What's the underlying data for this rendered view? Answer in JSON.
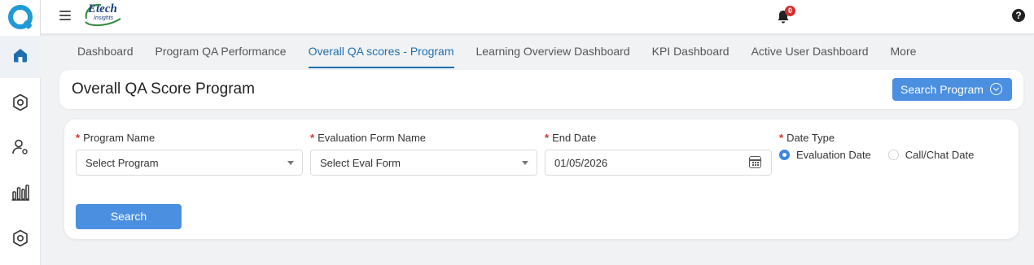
{
  "app": {
    "brand_name": "Etech",
    "brand_sub": "Insights",
    "notification_count": "0",
    "help_label": "?"
  },
  "nav_tabs": [
    {
      "label": "Dashboard"
    },
    {
      "label": "Program QA Performance"
    },
    {
      "label": "Overall QA scores - Program",
      "active": true
    },
    {
      "label": "Learning Overview Dashboard"
    },
    {
      "label": "KPI Dashboard"
    },
    {
      "label": "Active User Dashboard"
    },
    {
      "label": "More"
    }
  ],
  "page": {
    "title": "Overall QA Score Program",
    "search_program_label": "Search Program"
  },
  "form": {
    "required_mark": "*",
    "program_name": {
      "label": "Program Name",
      "value": "Select Program"
    },
    "eval_form": {
      "label": "Evaluation Form Name",
      "value": "Select Eval Form"
    },
    "end_date": {
      "label": "End Date",
      "value": "01/05/2026"
    },
    "date_type": {
      "label": "Date Type",
      "options": [
        "Evaluation Date",
        "Call/Chat Date"
      ],
      "selected": "Evaluation Date"
    },
    "search_label": "Search"
  },
  "sidebar_icons": [
    "app-logo-icon",
    "home-icon",
    "settings-shield-icon",
    "user-settings-icon",
    "bar-chart-icon",
    "settings-shield-icon"
  ],
  "colors": {
    "accent": "#1e6fb0",
    "button": "#4a8fe0",
    "required": "#d32f2f"
  }
}
